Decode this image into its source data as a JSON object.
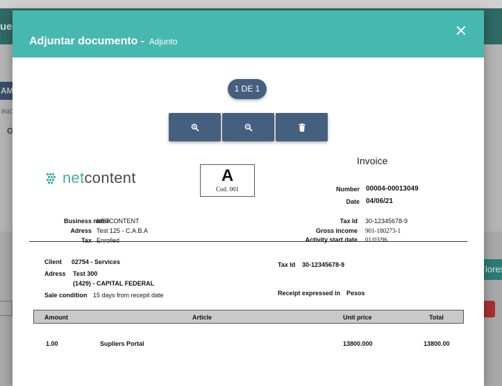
{
  "background": {
    "header_text": "ue",
    "am_tab": "AM",
    "inic_text": "INIC",
    "g_text": "G",
    "side_button": "lores"
  },
  "modal": {
    "title": "Adjuntar documento -",
    "subtitle": "Adjunto",
    "close_icon": "close-icon",
    "pager": "1 DE 1",
    "tools": [
      "zoom-in-icon",
      "zoom-out-icon",
      "trash-icon"
    ]
  },
  "invoice": {
    "logo": "netcontent",
    "letter": "A",
    "code": "Cod.   001",
    "title": "Invoice",
    "number_label": "Number",
    "number": "00004-00013049",
    "date_label": "Date",
    "date": "04/06/21",
    "issuer": {
      "business_name_label": "Business name",
      "business_name": "NETCONTENT",
      "address_label": "Adress",
      "address": "Test 125 - C.A.B.A",
      "tax_label": "Tax",
      "tax": "Enrolled"
    },
    "tax_info": {
      "tax_id_label": "Tax Id",
      "tax_id": "30-12345678-9",
      "gross_income_label": "Gross income",
      "gross_income": "901-180273-1",
      "activity_start_label": "Activity start date",
      "activity_start": "01/03/96"
    },
    "client": {
      "client_label": "Client",
      "client": "02754 -  Services",
      "address_label": "Adress",
      "address_line1": "Test 300",
      "address_line2": "(1429) - CAPITAL FEDERAL",
      "sale_condition_label": "Sale condition",
      "sale_condition": "15 days from recepit date",
      "tax_id_label": "Tax Id",
      "tax_id": "30-12345678-9",
      "receipt_label": "Receipt expressed in",
      "receipt": "Pesos"
    },
    "table": {
      "headers": [
        "Amount",
        "Article",
        "Unit price",
        "Total"
      ],
      "rows": [
        [
          "1.00",
          "Supliers Portal",
          "13800.000",
          "13800.00"
        ]
      ]
    }
  }
}
